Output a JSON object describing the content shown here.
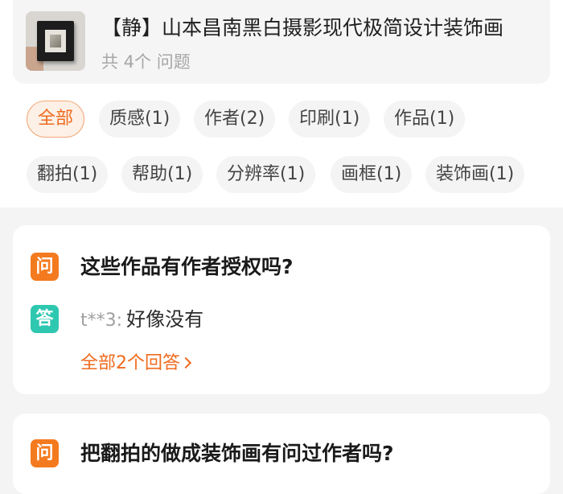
{
  "product": {
    "title": "【静】山本昌南黑白摄影现代极简设计装饰画",
    "question_count": "共 4个 问题"
  },
  "filters": [
    {
      "label": "全部",
      "active": true
    },
    {
      "label": "质感(1)"
    },
    {
      "label": "作者(2)"
    },
    {
      "label": "印刷(1)"
    },
    {
      "label": "作品(1)"
    },
    {
      "label": "翻拍(1)"
    },
    {
      "label": "帮助(1)"
    },
    {
      "label": "分辨率(1)"
    },
    {
      "label": "画框(1)"
    },
    {
      "label": "装饰画(1)"
    }
  ],
  "questions": [
    {
      "badge": "问",
      "text": "这些作品有作者授权吗?",
      "answer": {
        "badge": "答",
        "user": "t**3:",
        "text": "好像没有"
      },
      "all_answers": "全部2个回答"
    },
    {
      "badge": "问",
      "text": "把翻拍的做成装饰画有问过作者吗?"
    }
  ],
  "colors": {
    "accent_orange": "#f06a1d",
    "question_badge": "#f47a1f",
    "answer_badge": "#2ec7b0"
  }
}
